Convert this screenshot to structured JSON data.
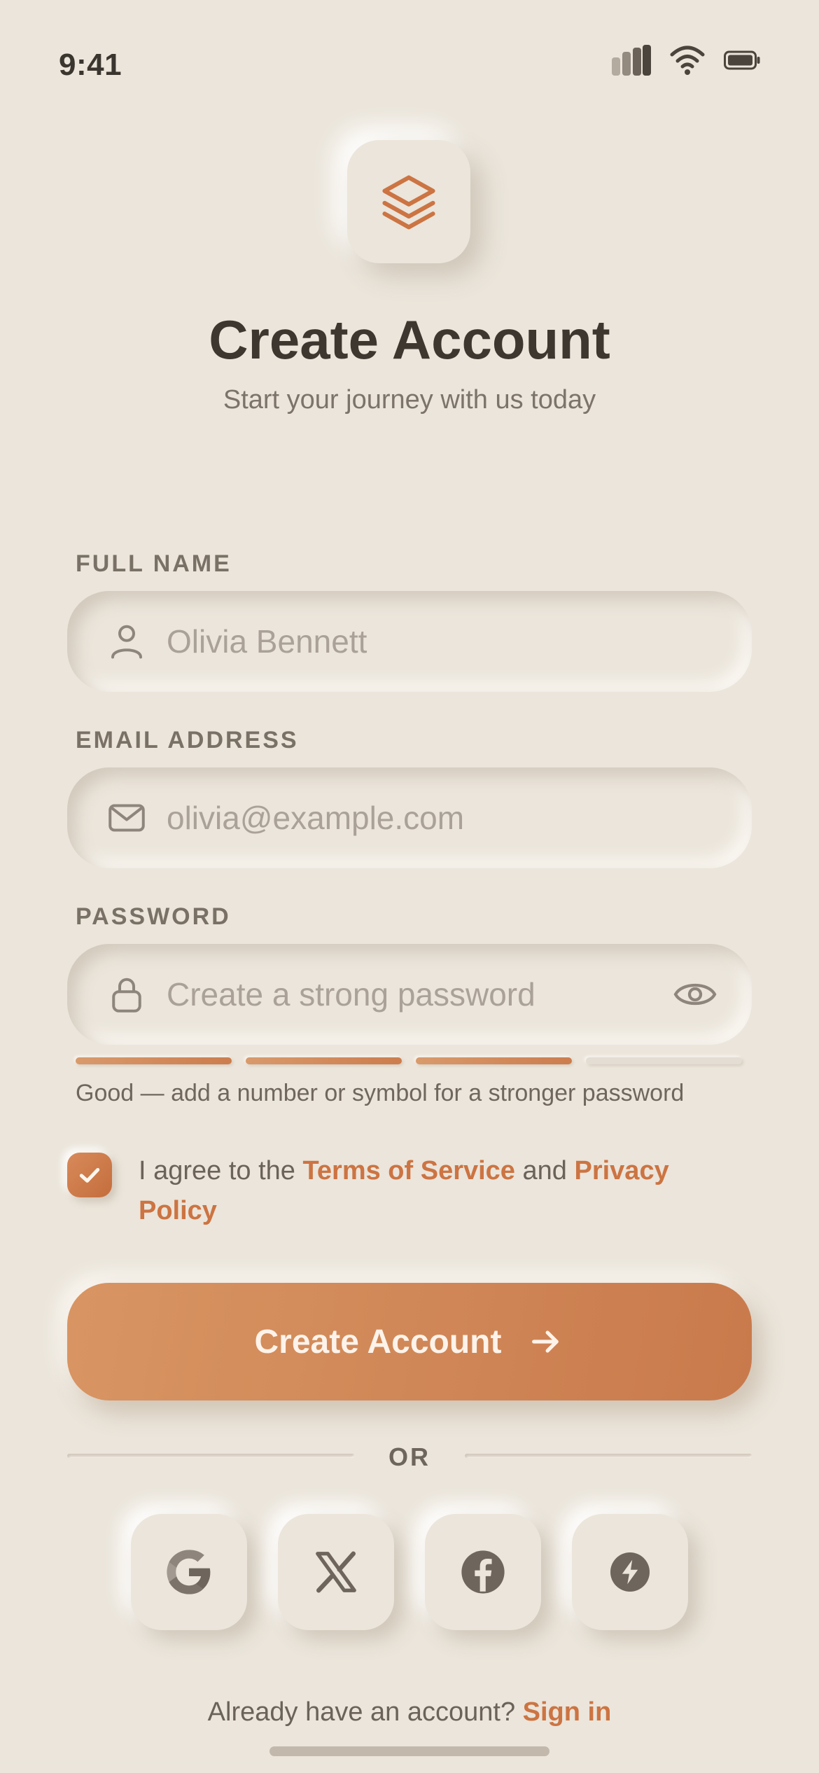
{
  "status_bar": {
    "time": "9:41",
    "icons": [
      "cellular-icon",
      "wifi-icon",
      "battery-icon"
    ]
  },
  "header": {
    "logo_icon": "layers-icon",
    "title": "Create Account",
    "subtitle": "Start your journey with us today"
  },
  "form": {
    "full_name": {
      "label": "FULL NAME",
      "placeholder": "Olivia Bennett",
      "icon": "user-icon"
    },
    "email": {
      "label": "EMAIL ADDRESS",
      "placeholder": "olivia@example.com",
      "icon": "mail-icon"
    },
    "password": {
      "label": "PASSWORD",
      "placeholder": "Create a strong password",
      "icon": "lock-icon",
      "toggle_icon": "eye-icon",
      "strength_segments_filled": 3,
      "strength_segments_total": 4,
      "strength_text": "Good — add a number or symbol for a stronger password"
    },
    "agreement": {
      "checked": true,
      "prefix": "I agree to the ",
      "terms_link": "Terms of Service",
      "middle": " and ",
      "privacy_link": "Privacy Policy"
    },
    "submit_label": "Create Account"
  },
  "divider_text": "OR",
  "social_buttons": [
    "google-icon",
    "x-icon",
    "facebook-icon",
    "lightning-icon"
  ],
  "footer": {
    "prompt": "Already have an account? ",
    "signin_link": "Sign in"
  },
  "colors": {
    "background": "#EBE5DB",
    "accent": "#CC7442",
    "text_dark": "#3D3730",
    "text_muted": "#7C746A"
  }
}
